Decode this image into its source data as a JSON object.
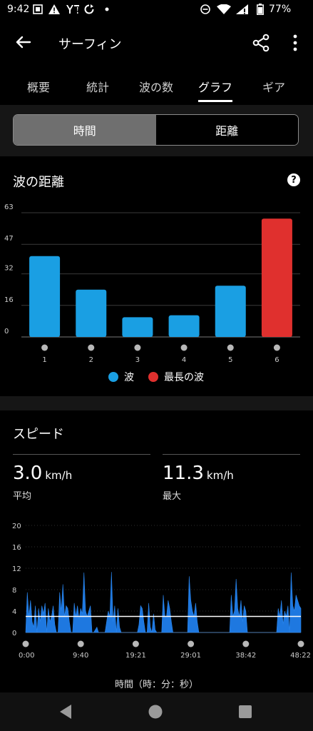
{
  "status": {
    "time": "9:42",
    "icons": [
      "notification-icon",
      "warning-icon",
      "yahoo-icon",
      "sync-icon",
      "dot-icon"
    ],
    "right_icons": [
      "dnd-icon",
      "wifi-icon",
      "signal-icon",
      "battery-icon"
    ],
    "battery": "77%"
  },
  "appbar": {
    "title": "サーフィン"
  },
  "tabs": [
    {
      "label": "概要"
    },
    {
      "label": "統計"
    },
    {
      "label": "波の数"
    },
    {
      "label": "グラフ"
    },
    {
      "label": "ギア"
    }
  ],
  "active_tab": 3,
  "toggle": {
    "time": "時間",
    "distance": "距離",
    "selected": "time"
  },
  "wave_card": {
    "title": "波の距離",
    "legend": {
      "wave": "波",
      "longest": "最長の波"
    },
    "colors": {
      "wave": "#1a9fe3",
      "longest": "#e0302e"
    }
  },
  "speed_card": {
    "title": "スピード",
    "avg_value": "3.0",
    "avg_unit": "km/h",
    "avg_label": "平均",
    "max_value": "11.3",
    "max_unit": "km/h",
    "max_label": "最大",
    "xtitle": "時間（時：分：秒）"
  },
  "chart_data": [
    {
      "type": "bar",
      "categories": [
        "1",
        "2",
        "3",
        "4",
        "5",
        "6"
      ],
      "values": [
        41,
        24,
        10,
        11,
        26,
        60
      ],
      "highlight_index": 5,
      "yticks": [
        "63",
        "47",
        "32",
        "16",
        "0"
      ],
      "ylim": [
        0,
        63
      ],
      "grid": true
    },
    {
      "type": "area",
      "x_ticks": [
        "0:00",
        "9:40",
        "19:21",
        "29:01",
        "38:42",
        "48:22"
      ],
      "yticks": [
        "20",
        "16",
        "12",
        "8",
        "4",
        "0"
      ],
      "ylim": [
        0,
        20
      ],
      "average_line": 3.0,
      "max": 11.3,
      "values": [
        0,
        7.5,
        3,
        6,
        2,
        1,
        5,
        0,
        4.5,
        2,
        5,
        3.5,
        5.5,
        0,
        4.5,
        2,
        3,
        5,
        1.5,
        0,
        0,
        7.5,
        4,
        9,
        3,
        5,
        4.5,
        2,
        0,
        0,
        5.5,
        3,
        5,
        2.5,
        4.5,
        3.5,
        11.2,
        4,
        3,
        4,
        5,
        0,
        0,
        0.5,
        1,
        0,
        0,
        0,
        0,
        0,
        2,
        4,
        3,
        11.3,
        2,
        5,
        0,
        4.5,
        1,
        0,
        0,
        0,
        0,
        0,
        0,
        0,
        0,
        0,
        0,
        0,
        1.5,
        5,
        4.5,
        2,
        0,
        0,
        5.5,
        1,
        0,
        3.5,
        0.5,
        0,
        0,
        0,
        0,
        7,
        3,
        3,
        6,
        4.5,
        2,
        0,
        0,
        0,
        0,
        0,
        0,
        0,
        0,
        0,
        0,
        10.5,
        6,
        4,
        3,
        5.5,
        2,
        0,
        0,
        0,
        0,
        0,
        0,
        0,
        0,
        0,
        0,
        0,
        0,
        0,
        0,
        0,
        0,
        0,
        0,
        0,
        0,
        7,
        3,
        4,
        10,
        4.5,
        3,
        6,
        2,
        5,
        4,
        0,
        0,
        0,
        0,
        0,
        0,
        0,
        0,
        0,
        0,
        0,
        0,
        0,
        0,
        0,
        0,
        0,
        0,
        0,
        4.5,
        3,
        6,
        1.5,
        4,
        3,
        5,
        0,
        11.2,
        5,
        4,
        7,
        6,
        5,
        4.5
      ]
    }
  ]
}
